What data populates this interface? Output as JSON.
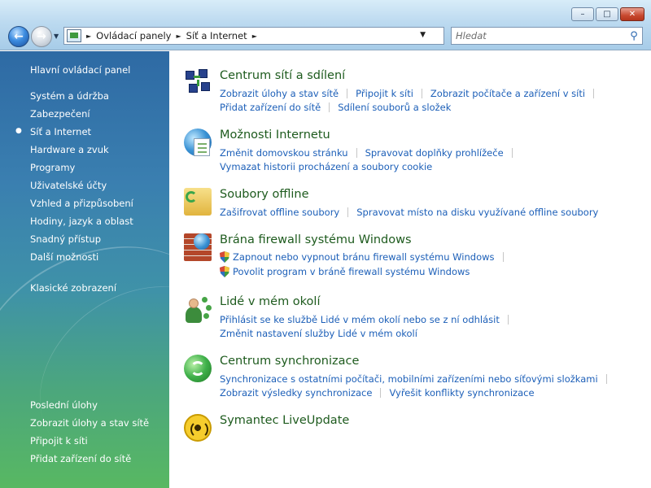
{
  "window": {
    "controls": {
      "minimize": "–",
      "maximize": "□",
      "close": "✕"
    }
  },
  "nav": {
    "back_icon": "←",
    "forward_icon": "→",
    "dropdown_icon": "▼"
  },
  "address": {
    "breadcrumbs": [
      "Ovládací panely",
      "Síť a Internet"
    ],
    "separator": "►",
    "dropdown_icon": "▼",
    "refresh_icon": "⇆"
  },
  "search": {
    "placeholder": "Hledat",
    "icon": "⚲"
  },
  "sidebar": {
    "home_label": "Hlavní ovládací panel",
    "categories": [
      "Systém a údržba",
      "Zabezpečení",
      "Síť a Internet",
      "Hardware a zvuk",
      "Programy",
      "Uživatelské účty",
      "Vzhled a přizpůsobení",
      "Hodiny, jazyk a oblast",
      "Snadný přístup",
      "Další možnosti"
    ],
    "classic_view": "Klasické zobrazení",
    "bullet": "●",
    "bottom_links": [
      "Poslední úlohy",
      "Zobrazit úlohy a stav sítě",
      "Připojit k síti",
      "Přidat zařízení do sítě"
    ]
  },
  "sections": [
    {
      "title": "Centrum sítí a sdílení",
      "icon": "network-center-icon",
      "tasks": [
        [
          "Zobrazit úlohy a stav sítě",
          "Připojit k síti",
          "Zobrazit počítače a zařízení v síti"
        ],
        [
          "Přidat zařízení do sítě",
          "Sdílení souborů a složek"
        ]
      ]
    },
    {
      "title": "Možnosti Internetu",
      "icon": "internet-options-icon",
      "tasks": [
        [
          "Změnit domovskou stránku",
          "Spravovat doplňky prohlížeče"
        ],
        [
          "Vymazat historii procházení a soubory cookie"
        ]
      ]
    },
    {
      "title": "Soubory offline",
      "icon": "offline-files-icon",
      "tasks": [
        [
          "Zašifrovat offline soubory",
          "Spravovat místo na disku využívané offline soubory"
        ]
      ]
    },
    {
      "title": "Brána firewall systému Windows",
      "icon": "firewall-icon",
      "tasks": [
        [
          "Zapnout nebo vypnout bránu firewall systému Windows"
        ],
        [
          "Povolit program v bráně firewall systému Windows"
        ]
      ]
    },
    {
      "title": "Lidé v mém okolí",
      "icon": "people-near-me-icon",
      "tasks": [
        [
          "Přihlásit se ke službě Lidé v mém okolí nebo se z ní odhlásit"
        ],
        [
          "Změnit nastavení služby Lidé v mém okolí"
        ]
      ]
    },
    {
      "title": "Centrum synchronizace",
      "icon": "sync-center-icon",
      "tasks": [
        [
          "Synchronizace s ostatními počítači, mobilními zařízeními nebo síťovými složkami"
        ],
        [
          "Zobrazit výsledky synchronizace",
          "Vyřešit konflikty synchronizace"
        ]
      ]
    },
    {
      "title": "Symantec LiveUpdate",
      "icon": "liveupdate-icon",
      "tasks": []
    }
  ],
  "colors": {
    "title_green": "#1e5b1e",
    "link_blue": "#1c5fb8",
    "sidebar_top": "#2e6aa4",
    "sidebar_bottom": "#58b862"
  }
}
